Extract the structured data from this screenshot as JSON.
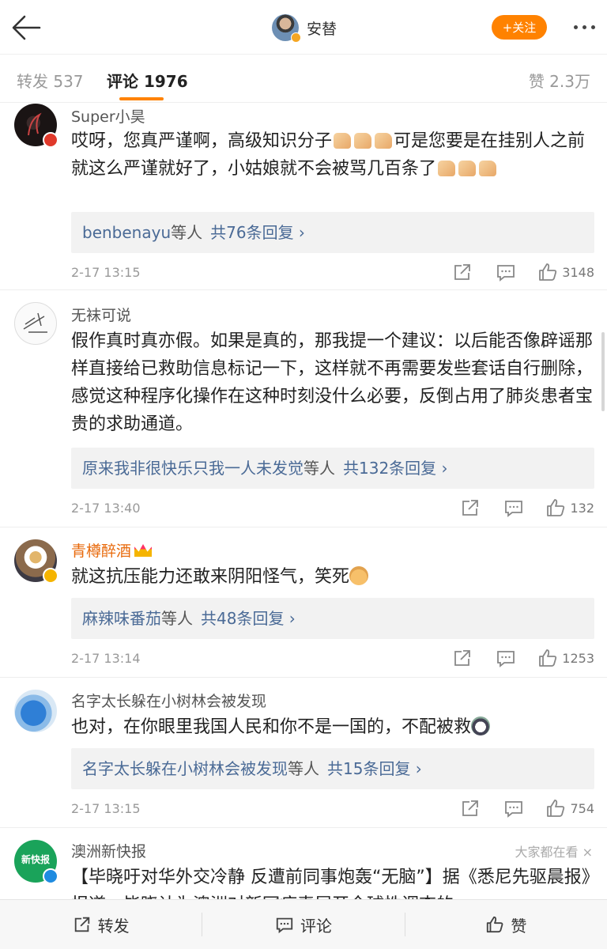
{
  "header": {
    "back_icon": "arrow-left-icon",
    "user_name": "安替",
    "follow_label": "+关注",
    "more_icon": "more-dots-icon"
  },
  "tabs": {
    "repost_label": "转发 537",
    "comment_label": "评论 1976",
    "like_label": "赞 2.3万"
  },
  "comments": [
    {
      "user": "Super小昊",
      "text_parts": [
        "哎呀，您真严谨啊，高级知识分子",
        "可是您要是在挂别人之前就这么严谨就好了，小姑娘就不会被骂几百条了"
      ],
      "reply_names": "benbenayu",
      "reply_suffix": "等人",
      "reply_count": "共76条回复 ›",
      "time": "2-17 13:15",
      "likes": "3148"
    },
    {
      "user": "无袜可说",
      "text": "假作真时真亦假。如果是真的，那我提一个建议：以后能否像辟谣那样直接给已救助信息标记一下，这样就不再需要发些套话自行删除，感觉这种程序化操作在这种时刻没什么必要，反倒占用了肺炎患者宝贵的求助通道。",
      "reply_names": "原来我非很快乐只我一人未发觉",
      "reply_suffix": "等人",
      "reply_count": "共132条回复 ›",
      "time": "2-17 13:40",
      "likes": "132"
    },
    {
      "user": "青樽醉酒",
      "text": "就这抗压能力还敢来阴阳怪气，笑死",
      "reply_names": "麻辣味番茄",
      "reply_suffix": "等人",
      "reply_count": "共48条回复 ›",
      "time": "2-17 13:14",
      "likes": "1253"
    },
    {
      "user": "名字太长躲在小树林会被发现",
      "text": "也对，在你眼里我国人民和你不是一国的，不配被救",
      "reply_names": "名字太长躲在小树林会被发现",
      "reply_suffix": "等人",
      "reply_count": "共15条回复 ›",
      "time": "2-17 13:15",
      "likes": "754"
    },
    {
      "user": "澳洲新快报",
      "avatar_text": "新快报",
      "ad_tag": "大家都在看 ×",
      "text": "【毕晓吁对华外交冷静 反遭前同事炮轰“无脑”】据《悉尼先驱晨报》报道，毕晓认为澳洲对新冠病毒展开全球性调查的"
    }
  ],
  "bottom": {
    "repost_label": "转发",
    "comment_label": "评论",
    "like_label": "赞"
  }
}
